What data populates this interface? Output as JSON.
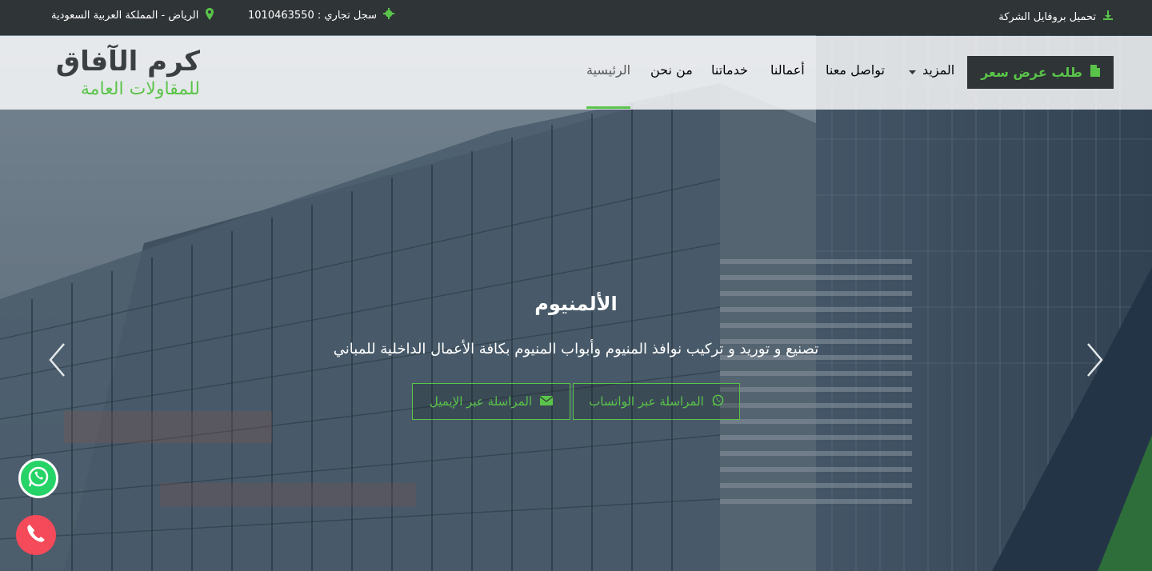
{
  "topbar": {
    "profile_download": "تحميل بروفايل الشركة",
    "commercial_register": "سجل تجاري : 1010463550",
    "location": "الرياض - المملكة العربية السعودية"
  },
  "logo": {
    "line1": "كرم الآفاق",
    "line2": "للمقاولات العامة"
  },
  "nav": {
    "home": "الرئيسية",
    "about": "من نحن",
    "services": "خدماتنا",
    "works": "أعمالنا",
    "contact": "تواصل معنا",
    "more": "المزيد",
    "quote_button": "طلب عرض سعر"
  },
  "hero": {
    "title": "الألمنيوم",
    "subtitle": "تصنيع و توريد و تركيب نوافذ المنيوم وأبواب المنيوم بكافة الأعمال الداخلية للمباني",
    "whatsapp_button": "المراسلة عبر الواتساب",
    "email_button": "المراسلة عبر الإيميل"
  },
  "colors": {
    "accent": "#5ac44a",
    "dark": "#2f3436",
    "whatsapp": "#25d366",
    "phone": "#f44a5a"
  },
  "icons": [
    "download-icon",
    "gear-icon",
    "map-marker-icon",
    "file-icon",
    "caret-down-icon",
    "whatsapp-icon",
    "envelope-icon",
    "chevron-left-icon",
    "chevron-right-icon",
    "phone-icon"
  ]
}
